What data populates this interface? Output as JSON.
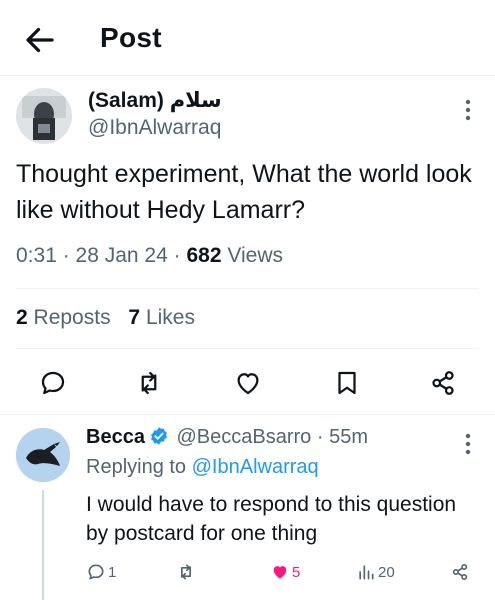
{
  "header": {
    "title": "Post"
  },
  "tweet": {
    "author_name": "(Salam) سلام",
    "author_handle": "@IbnAlwarraq",
    "text": "Thought experiment, What the world look like without Hedy Lamarr?",
    "time": "0:31",
    "date": "28 Jan 24",
    "views_count": "682",
    "views_label": "Views",
    "reposts_count": "2",
    "reposts_label": "Reposts",
    "likes_count": "7",
    "likes_label": "Likes"
  },
  "reply": {
    "author_name": "Becca",
    "author_handle": "@BeccaBsarro",
    "time": "55m",
    "replying_prefix": "Replying to",
    "replying_handle": "@IbnAlwarraq",
    "text": "I would have to respond to this question by postcard for one thing",
    "reply_count": "1",
    "like_count": "5",
    "view_count": "20"
  },
  "icons": {
    "back": "arrow-left-icon",
    "more": "more-vertical-icon",
    "reply": "reply-icon",
    "repost": "repost-icon",
    "like": "heart-icon",
    "bookmark": "bookmark-icon",
    "share": "share-icon",
    "views": "views-icon",
    "verified": "verified-badge-icon"
  },
  "colors": {
    "accent": "#1d9bf0",
    "like_active": "#f91880",
    "secondary_text": "#536471"
  }
}
